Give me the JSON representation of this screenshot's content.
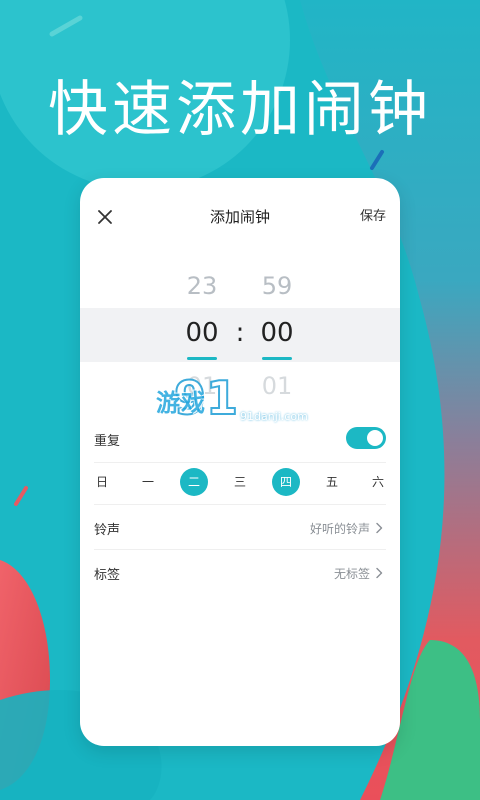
{
  "headline": "快速添加闹钟",
  "header": {
    "title": "添加闹钟",
    "save_label": "保存"
  },
  "picker": {
    "hour_prev": "23",
    "minute_prev": "59",
    "hour_current": "00",
    "minute_current": "00",
    "hour_next": "01",
    "minute_next": "01",
    "separator": ":"
  },
  "watermark": {
    "text": "游戏",
    "sub": "91danji.com"
  },
  "repeat": {
    "label": "重复",
    "enabled": true
  },
  "days": [
    {
      "label": "日",
      "selected": false
    },
    {
      "label": "一",
      "selected": false
    },
    {
      "label": "二",
      "selected": true
    },
    {
      "label": "三",
      "selected": false
    },
    {
      "label": "四",
      "selected": true
    },
    {
      "label": "五",
      "selected": false
    },
    {
      "label": "六",
      "selected": false
    }
  ],
  "ringtone": {
    "label": "铃声",
    "value": "好听的铃声"
  },
  "tag": {
    "label": "标签",
    "value": "无标签"
  },
  "colors": {
    "accent": "#1cb8c4",
    "background_teal": "#1cb8c4",
    "background_red": "#e8515e",
    "background_green": "#3cc281"
  },
  "icons": {
    "close": "close-icon",
    "chevron": "chevron-right-icon"
  }
}
